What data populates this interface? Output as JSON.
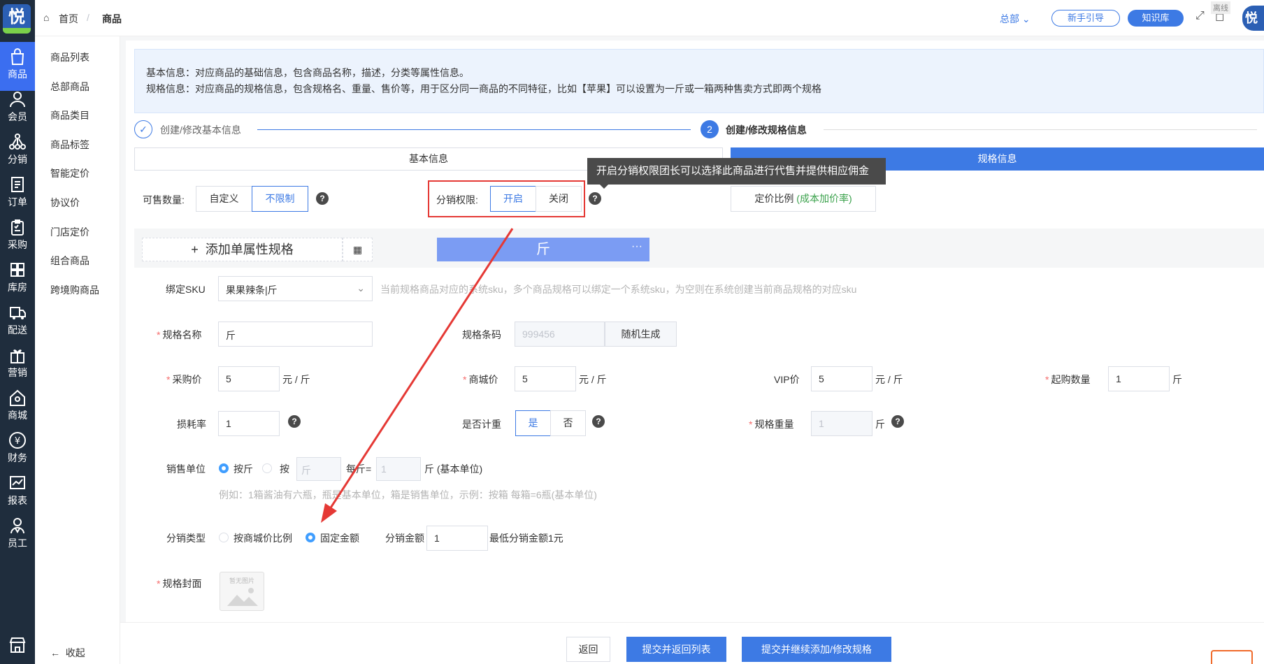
{
  "app": {
    "logo_char": "悦"
  },
  "topbar": {
    "breadcrumb_home": "首页",
    "breadcrumb_sep": "/",
    "breadcrumb_current": "商品",
    "hq_dropdown": "总部",
    "guide_btn": "新手引导",
    "knowledge_btn": "知识库",
    "offline_badge": "离线"
  },
  "nav": [
    {
      "label": "商品",
      "icon": "bag-icon",
      "active": true
    },
    {
      "label": "会员",
      "icon": "user-icon"
    },
    {
      "label": "分销",
      "icon": "network-icon"
    },
    {
      "label": "订单",
      "icon": "order-icon"
    },
    {
      "label": "采购",
      "icon": "clipboard-icon"
    },
    {
      "label": "库房",
      "icon": "warehouse-icon"
    },
    {
      "label": "配送",
      "icon": "truck-icon"
    },
    {
      "label": "营销",
      "icon": "gift-icon"
    },
    {
      "label": "商城",
      "icon": "store-icon"
    },
    {
      "label": "财务",
      "icon": "yen-icon"
    },
    {
      "label": "报表",
      "icon": "chart-icon"
    },
    {
      "label": "员工",
      "icon": "staff-icon"
    }
  ],
  "subnav": [
    "商品列表",
    "总部商品",
    "商品类目",
    "商品标签",
    "智能定价",
    "协议价",
    "门店定价",
    "组合商品",
    "跨境购商品"
  ],
  "subnav_collapse": "收起",
  "info": {
    "line1": "基本信息：对应商品的基础信息，包含商品名称，描述，分类等属性信息。",
    "line2": "规格信息：对应商品的规格信息，包含规格名、重量、售价等，用于区分同一商品的不同特征，比如【苹果】可以设置为一斤或一箱两种售卖方式即两个规格"
  },
  "steps": {
    "step1": "创建/修改基本信息",
    "step2_num": "2",
    "step2": "创建/修改规格信息"
  },
  "tabs": {
    "basic": "基本信息",
    "spec": "规格信息"
  },
  "tooltip": "开启分销权限团长可以选择此商品进行代售并提供相应佣金",
  "sale_qty": {
    "label": "可售数量:",
    "custom": "自定义",
    "unlimited": "不限制"
  },
  "dist_perm": {
    "label": "分销权限:",
    "on": "开启",
    "off": "关闭"
  },
  "pricing_ratio": {
    "label": "定价比例",
    "hint": "(成本加价率)"
  },
  "add_spec": {
    "plus": "+",
    "label": "添加单属性规格"
  },
  "spec_tab": {
    "name": "斤",
    "more": "···"
  },
  "form": {
    "bind_sku_label": "绑定SKU",
    "bind_sku_value": "果果辣条|斤",
    "bind_sku_hint": "当前规格商品对应的系统sku，多个商品规格可以绑定一个系统sku，为空则在系统创建当前商品规格的对应sku",
    "spec_name_label": "规格名称",
    "spec_name_value": "斤",
    "barcode_label": "规格条码",
    "barcode_value": "999456",
    "barcode_gen": "随机生成",
    "purchase_label": "采购价",
    "purchase_value": "5",
    "mall_label": "商城价",
    "mall_value": "5",
    "vip_label": "VIP价",
    "vip_value": "5",
    "unit_yuan_jin": "元 / 斤",
    "min_qty_label": "起购数量",
    "min_qty_value": "1",
    "min_qty_unit": "斤",
    "loss_label": "损耗率",
    "loss_value": "1",
    "weigh_label": "是否计重",
    "weigh_yes": "是",
    "weigh_no": "否",
    "spec_weight_label": "规格重量",
    "spec_weight_value": "1",
    "spec_weight_unit": "斤",
    "sale_unit_label": "销售单位",
    "sale_unit_opt1": "按斤",
    "sale_unit_opt2": "按",
    "sale_unit_box": "斤",
    "per_label": "每斤=",
    "per_value": "1",
    "per_unit": "斤 (基本单位)",
    "sale_unit_hint": "例如：1箱酱油有六瓶，瓶是基本单位，箱是销售单位，示例：按箱 每箱=6瓶(基本单位)",
    "dist_type_label": "分销类型",
    "dist_type_opt1": "按商城价比例",
    "dist_type_opt2": "固定金额",
    "dist_amount_label": "分销金额",
    "dist_amount_value": "1",
    "dist_amount_hint": "最低分销金额1元",
    "cover_label": "规格封面",
    "cover_placeholder": "暂无图片"
  },
  "footer": {
    "back": "返回",
    "submit_back": "提交并返回列表",
    "submit_continue": "提交并继续添加/修改规格"
  },
  "colors": {
    "primary": "#3d7ae4",
    "sidebar": "#1f2d3d",
    "annotation": "#e53935"
  }
}
